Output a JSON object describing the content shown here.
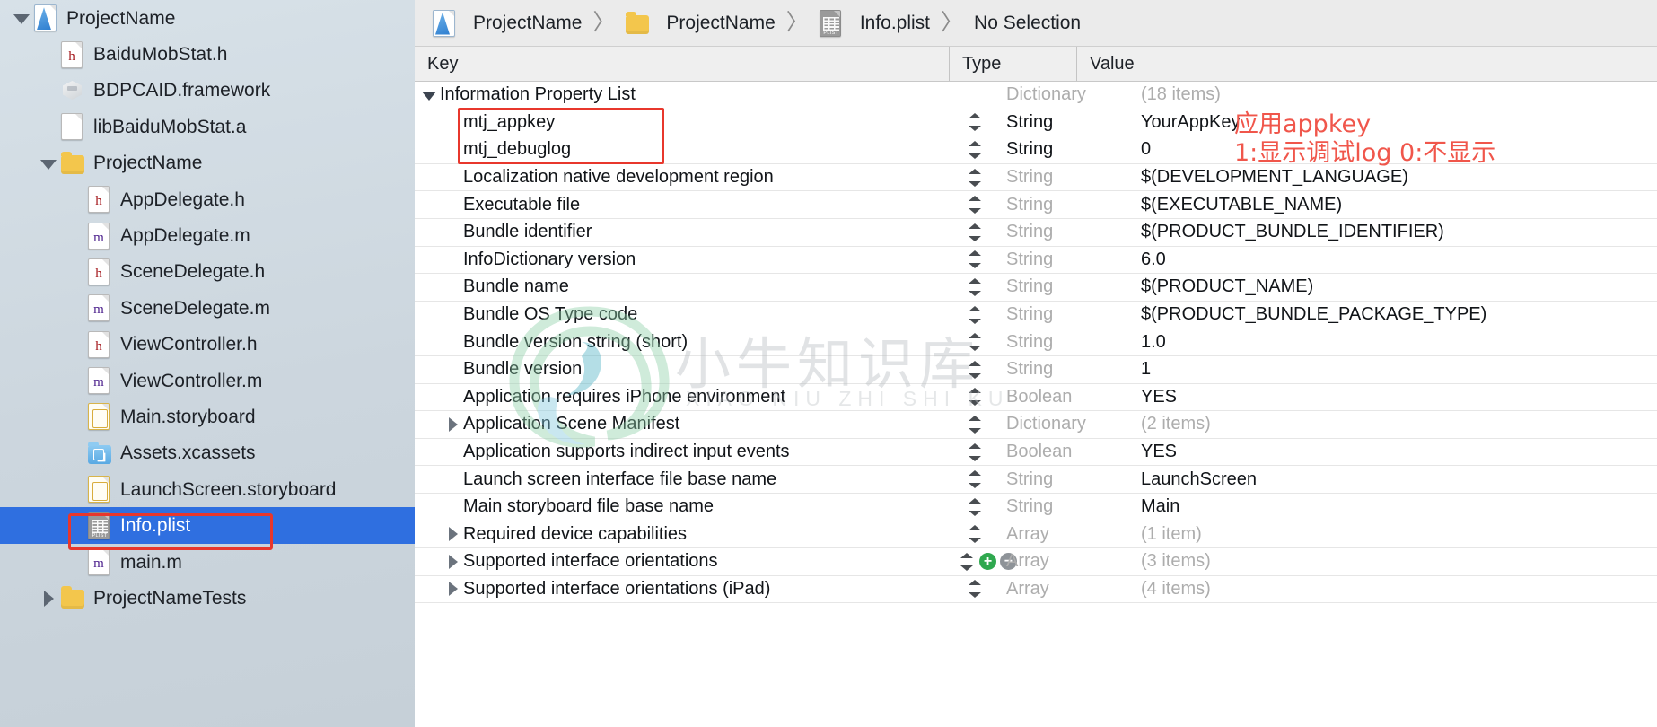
{
  "sidebar": {
    "items": [
      {
        "label": "ProjectName",
        "icon": "app-icon",
        "indent": 0,
        "disclosure": "open",
        "selected": false
      },
      {
        "label": "BaiduMobStat.h",
        "icon": "header-file-icon",
        "indent": 1,
        "disclosure": "none",
        "selected": false
      },
      {
        "label": "BDPCAID.framework",
        "icon": "framework-icon",
        "indent": 1,
        "disclosure": "none",
        "selected": false
      },
      {
        "label": "libBaiduMobStat.a",
        "icon": "library-file-icon",
        "indent": 1,
        "disclosure": "none",
        "selected": false
      },
      {
        "label": "ProjectName",
        "icon": "folder-icon",
        "indent": 1,
        "disclosure": "open",
        "selected": false
      },
      {
        "label": "AppDelegate.h",
        "icon": "header-file-icon",
        "indent": 2,
        "disclosure": "none",
        "selected": false
      },
      {
        "label": "AppDelegate.m",
        "icon": "source-file-icon",
        "indent": 2,
        "disclosure": "none",
        "selected": false
      },
      {
        "label": "SceneDelegate.h",
        "icon": "header-file-icon",
        "indent": 2,
        "disclosure": "none",
        "selected": false
      },
      {
        "label": "SceneDelegate.m",
        "icon": "source-file-icon",
        "indent": 2,
        "disclosure": "none",
        "selected": false
      },
      {
        "label": "ViewController.h",
        "icon": "header-file-icon",
        "indent": 2,
        "disclosure": "none",
        "selected": false
      },
      {
        "label": "ViewController.m",
        "icon": "source-file-icon",
        "indent": 2,
        "disclosure": "none",
        "selected": false
      },
      {
        "label": "Main.storyboard",
        "icon": "storyboard-icon",
        "indent": 2,
        "disclosure": "none",
        "selected": false
      },
      {
        "label": "Assets.xcassets",
        "icon": "xcassets-icon",
        "indent": 2,
        "disclosure": "none",
        "selected": false
      },
      {
        "label": "LaunchScreen.storyboard",
        "icon": "storyboard-icon",
        "indent": 2,
        "disclosure": "none",
        "selected": false
      },
      {
        "label": "Info.plist",
        "icon": "plist-icon",
        "indent": 2,
        "disclosure": "none",
        "selected": true
      },
      {
        "label": "main.m",
        "icon": "source-file-icon",
        "indent": 2,
        "disclosure": "none",
        "selected": false
      },
      {
        "label": "ProjectNameTests",
        "icon": "folder-icon",
        "indent": 1,
        "disclosure": "closed",
        "selected": false
      }
    ]
  },
  "breadcrumb": {
    "separator": "〉",
    "items": [
      {
        "label": "ProjectName",
        "icon": "app-icon"
      },
      {
        "label": "ProjectName",
        "icon": "folder-icon"
      },
      {
        "label": "Info.plist",
        "icon": "plist-icon"
      },
      {
        "label": "No Selection",
        "icon": "none"
      }
    ]
  },
  "table": {
    "columns": {
      "key": "Key",
      "type": "Type",
      "value": "Value"
    },
    "rows": [
      {
        "key": "Information Property List",
        "disclosure": "open",
        "indent": 0,
        "stepper": false,
        "type": "Dictionary",
        "type_dim": true,
        "value": "(18 items)",
        "value_dim": true
      },
      {
        "key": "mtj_appkey",
        "disclosure": "none",
        "indent": 1,
        "stepper": true,
        "type": "String",
        "type_dim": false,
        "value": "YourAppKey",
        "value_dim": false
      },
      {
        "key": "mtj_debuglog",
        "disclosure": "none",
        "indent": 1,
        "stepper": true,
        "type": "String",
        "type_dim": false,
        "value": "0",
        "value_dim": false
      },
      {
        "key": "Localization native development region",
        "disclosure": "none",
        "indent": 1,
        "stepper": true,
        "type": "String",
        "type_dim": true,
        "value": "$(DEVELOPMENT_LANGUAGE)",
        "value_dim": false
      },
      {
        "key": "Executable file",
        "disclosure": "none",
        "indent": 1,
        "stepper": true,
        "type": "String",
        "type_dim": true,
        "value": "$(EXECUTABLE_NAME)",
        "value_dim": false
      },
      {
        "key": "Bundle identifier",
        "disclosure": "none",
        "indent": 1,
        "stepper": true,
        "type": "String",
        "type_dim": true,
        "value": "$(PRODUCT_BUNDLE_IDENTIFIER)",
        "value_dim": false
      },
      {
        "key": "InfoDictionary version",
        "disclosure": "none",
        "indent": 1,
        "stepper": true,
        "type": "String",
        "type_dim": true,
        "value": "6.0",
        "value_dim": false
      },
      {
        "key": "Bundle name",
        "disclosure": "none",
        "indent": 1,
        "stepper": true,
        "type": "String",
        "type_dim": true,
        "value": "$(PRODUCT_NAME)",
        "value_dim": false
      },
      {
        "key": "Bundle OS Type code",
        "disclosure": "none",
        "indent": 1,
        "stepper": true,
        "type": "String",
        "type_dim": true,
        "value": "$(PRODUCT_BUNDLE_PACKAGE_TYPE)",
        "value_dim": false
      },
      {
        "key": "Bundle version string (short)",
        "disclosure": "none",
        "indent": 1,
        "stepper": true,
        "type": "String",
        "type_dim": true,
        "value": "1.0",
        "value_dim": false
      },
      {
        "key": "Bundle version",
        "disclosure": "none",
        "indent": 1,
        "stepper": true,
        "type": "String",
        "type_dim": true,
        "value": "1",
        "value_dim": false
      },
      {
        "key": "Application requires iPhone environment",
        "disclosure": "none",
        "indent": 1,
        "stepper": true,
        "type": "Boolean",
        "type_dim": true,
        "value": "YES",
        "value_dim": false
      },
      {
        "key": "Application Scene Manifest",
        "disclosure": "closed",
        "indent": 1,
        "stepper": true,
        "type": "Dictionary",
        "type_dim": true,
        "value": "(2 items)",
        "value_dim": true
      },
      {
        "key": "Application supports indirect input events",
        "disclosure": "none",
        "indent": 1,
        "stepper": true,
        "type": "Boolean",
        "type_dim": true,
        "value": "YES",
        "value_dim": false
      },
      {
        "key": "Launch screen interface file base name",
        "disclosure": "none",
        "indent": 1,
        "stepper": true,
        "type": "String",
        "type_dim": true,
        "value": "LaunchScreen",
        "value_dim": false
      },
      {
        "key": "Main storyboard file base name",
        "disclosure": "none",
        "indent": 1,
        "stepper": true,
        "type": "String",
        "type_dim": true,
        "value": "Main",
        "value_dim": false
      },
      {
        "key": "Required device capabilities",
        "disclosure": "closed",
        "indent": 1,
        "stepper": true,
        "type": "Array",
        "type_dim": true,
        "value": "(1 item)",
        "value_dim": true
      },
      {
        "key": "Supported interface orientations",
        "disclosure": "closed",
        "indent": 1,
        "stepper": true,
        "plusminus": true,
        "type": "Array",
        "type_dim": true,
        "value": "(3 items)",
        "value_dim": true
      },
      {
        "key": "Supported interface orientations (iPad)",
        "disclosure": "closed",
        "indent": 1,
        "stepper": true,
        "type": "Array",
        "type_dim": true,
        "value": "(4 items)",
        "value_dim": true
      }
    ]
  },
  "annotations": {
    "appkey_note": "应用appkey",
    "debuglog_note": "1:显示调试log 0:不显示",
    "highlight_color": "#e8372c",
    "note_color": "#f0564b"
  },
  "watermark": {
    "text": "小牛知识库",
    "subtext": "XIAO  NIU  ZHI  SHI  KU"
  },
  "stepper_buttons": {
    "plus": "+",
    "minus": "−"
  }
}
